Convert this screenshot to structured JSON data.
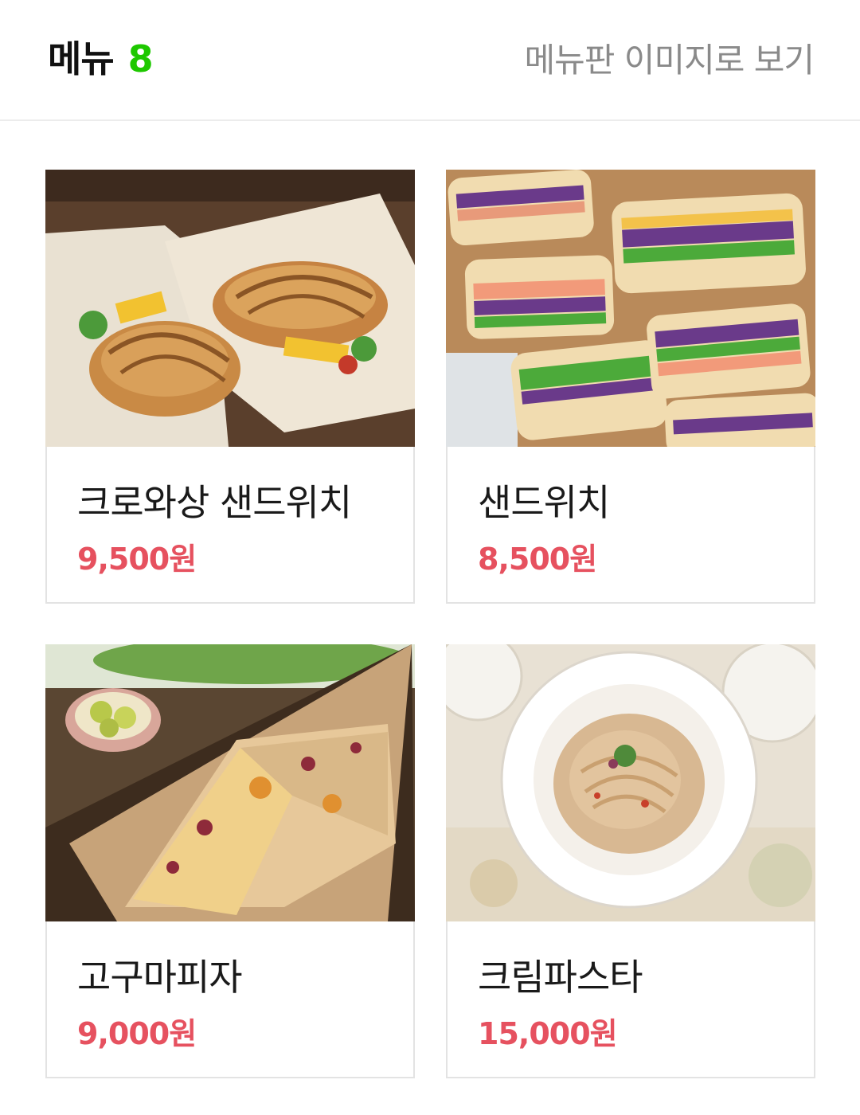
{
  "header": {
    "title": "메뉴",
    "count": "8",
    "image_view_link": "메뉴판 이미지로 보기",
    "accent_color": "#1ec800"
  },
  "menu_items": [
    {
      "name": "크로와상 샌드위치",
      "price": "9,500원",
      "photo": "croissant-sandwich-photo"
    },
    {
      "name": "샌드위치",
      "price": "8,500원",
      "photo": "sandwich-photo"
    },
    {
      "name": "고구마피자",
      "price": "9,000원",
      "photo": "sweet-potato-pizza-photo"
    },
    {
      "name": "크림파스타",
      "price": "15,000원",
      "photo": "cream-pasta-photo"
    }
  ],
  "price_color": "#e6515f"
}
